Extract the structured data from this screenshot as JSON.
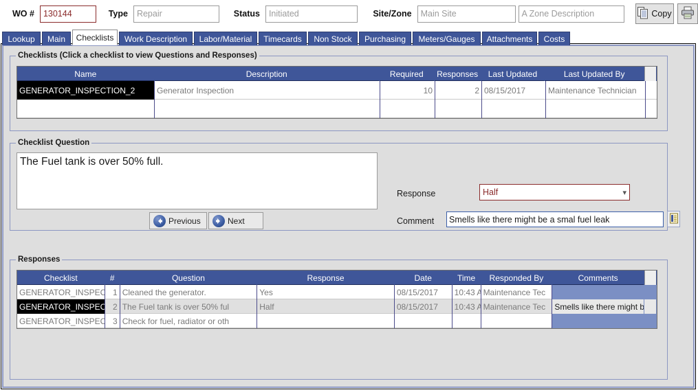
{
  "header": {
    "wo_label": "WO #",
    "wo_value": "130144",
    "type_label": "Type",
    "type_value": "Repair",
    "status_label": "Status",
    "status_value": "Initiated",
    "sitezone_label": "Site/Zone",
    "site_value": "Main Site",
    "zone_value": "A Zone Description",
    "copy_label": "Copy",
    "accent_red": "#8a2b2b",
    "accent_blue": "#3f5699"
  },
  "tabs": [
    {
      "label": "Lookup",
      "active": false
    },
    {
      "label": "Main",
      "active": false
    },
    {
      "label": "Checklists",
      "active": true
    },
    {
      "label": "Work Description",
      "active": false
    },
    {
      "label": "Labor/Material",
      "active": false
    },
    {
      "label": "Timecards",
      "active": false
    },
    {
      "label": "Non Stock",
      "active": false
    },
    {
      "label": "Purchasing",
      "active": false
    },
    {
      "label": "Meters/Gauges",
      "active": false
    },
    {
      "label": "Attachments",
      "active": false
    },
    {
      "label": "Costs",
      "active": false
    }
  ],
  "checklists": {
    "title": "Checklists (Click a checklist to view Questions and Responses)",
    "columns": [
      "Name",
      "Description",
      "Required",
      "Responses",
      "Last Updated",
      "Last Updated By"
    ],
    "rows": [
      {
        "name": "GENERATOR_INSPECTION_2",
        "description": "Generator Inspection",
        "required": "10",
        "responses": "2",
        "last_updated": "08/15/2017",
        "last_updated_by": "Maintenance Technician",
        "selected": true
      },
      {
        "name": "",
        "description": "",
        "required": "",
        "responses": "",
        "last_updated": "",
        "last_updated_by": "",
        "selected": false
      }
    ]
  },
  "question_panel": {
    "title": "Checklist Question",
    "question_text": "The Fuel tank is over 50% full.",
    "previous_label": "Previous",
    "next_label": "Next",
    "response_label": "Response",
    "response_value": "Half",
    "comment_label": "Comment",
    "comment_value": "Smells like there might be a smal fuel leak"
  },
  "responses": {
    "title": "Responses",
    "columns": [
      "Checklist",
      "#",
      "Question",
      "Response",
      "Date",
      "Time",
      "Responded By",
      "Comments"
    ],
    "rows": [
      {
        "checklist": "GENERATOR_INSPEC",
        "num": "1",
        "question": "Cleaned the generator.",
        "response": "Yes",
        "date": "08/15/2017",
        "time": "10:43 A",
        "responded_by": "Maintenance Tec",
        "comments": "",
        "selected": false
      },
      {
        "checklist": "GENERATOR_INSPEC",
        "num": "2",
        "question": "The Fuel tank is over 50% ful",
        "response": "Half",
        "date": "08/15/2017",
        "time": "10:43 A",
        "responded_by": "Maintenance Tec",
        "comments": "Smells like there might be a sm",
        "selected": true
      },
      {
        "checklist": "GENERATOR_INSPEC",
        "num": "3",
        "question": "Check for fuel, radiator or oth",
        "response": "",
        "date": "",
        "time": "",
        "responded_by": "",
        "comments": "",
        "selected": false
      }
    ]
  }
}
